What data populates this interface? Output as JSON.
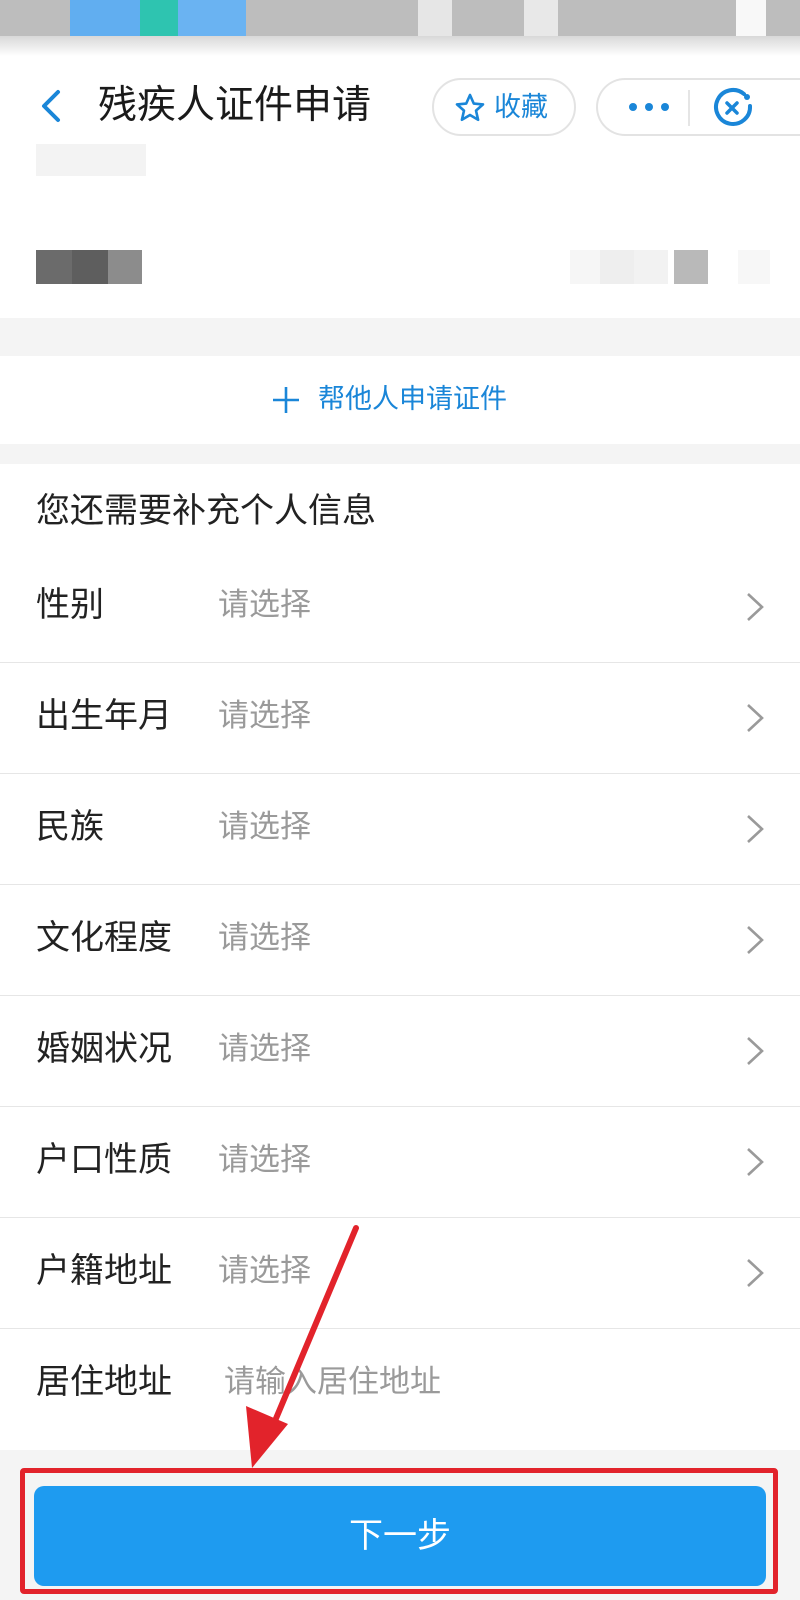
{
  "header": {
    "title": "残疾人证件申请",
    "favorite_label": "收藏"
  },
  "help_action": {
    "label": "帮他人申请证件"
  },
  "form": {
    "section_title": "您还需要补充个人信息",
    "rows": [
      {
        "label": "性别",
        "value": "请选择"
      },
      {
        "label": "出生年月",
        "value": "请选择"
      },
      {
        "label": "民族",
        "value": "请选择"
      },
      {
        "label": "文化程度",
        "value": "请选择"
      },
      {
        "label": "婚姻状况",
        "value": "请选择"
      },
      {
        "label": "户口性质",
        "value": "请选择"
      },
      {
        "label": "户籍地址",
        "value": "请选择"
      }
    ],
    "address": {
      "label": "居住地址",
      "placeholder": "请输入居住地址"
    }
  },
  "next_button": {
    "label": "下一步"
  },
  "colors": {
    "accent": "#1e9bf0",
    "link_blue": "#1a86d8",
    "annotation_red": "#e2232b",
    "placeholder_gray": "#9a9a9a"
  },
  "icons": {
    "back": "chevron-left-icon",
    "favorite": "star-icon",
    "more": "more-dots-icon",
    "close": "close-circle-icon",
    "add": "plus-icon",
    "row_arrow": "chevron-right-icon"
  }
}
